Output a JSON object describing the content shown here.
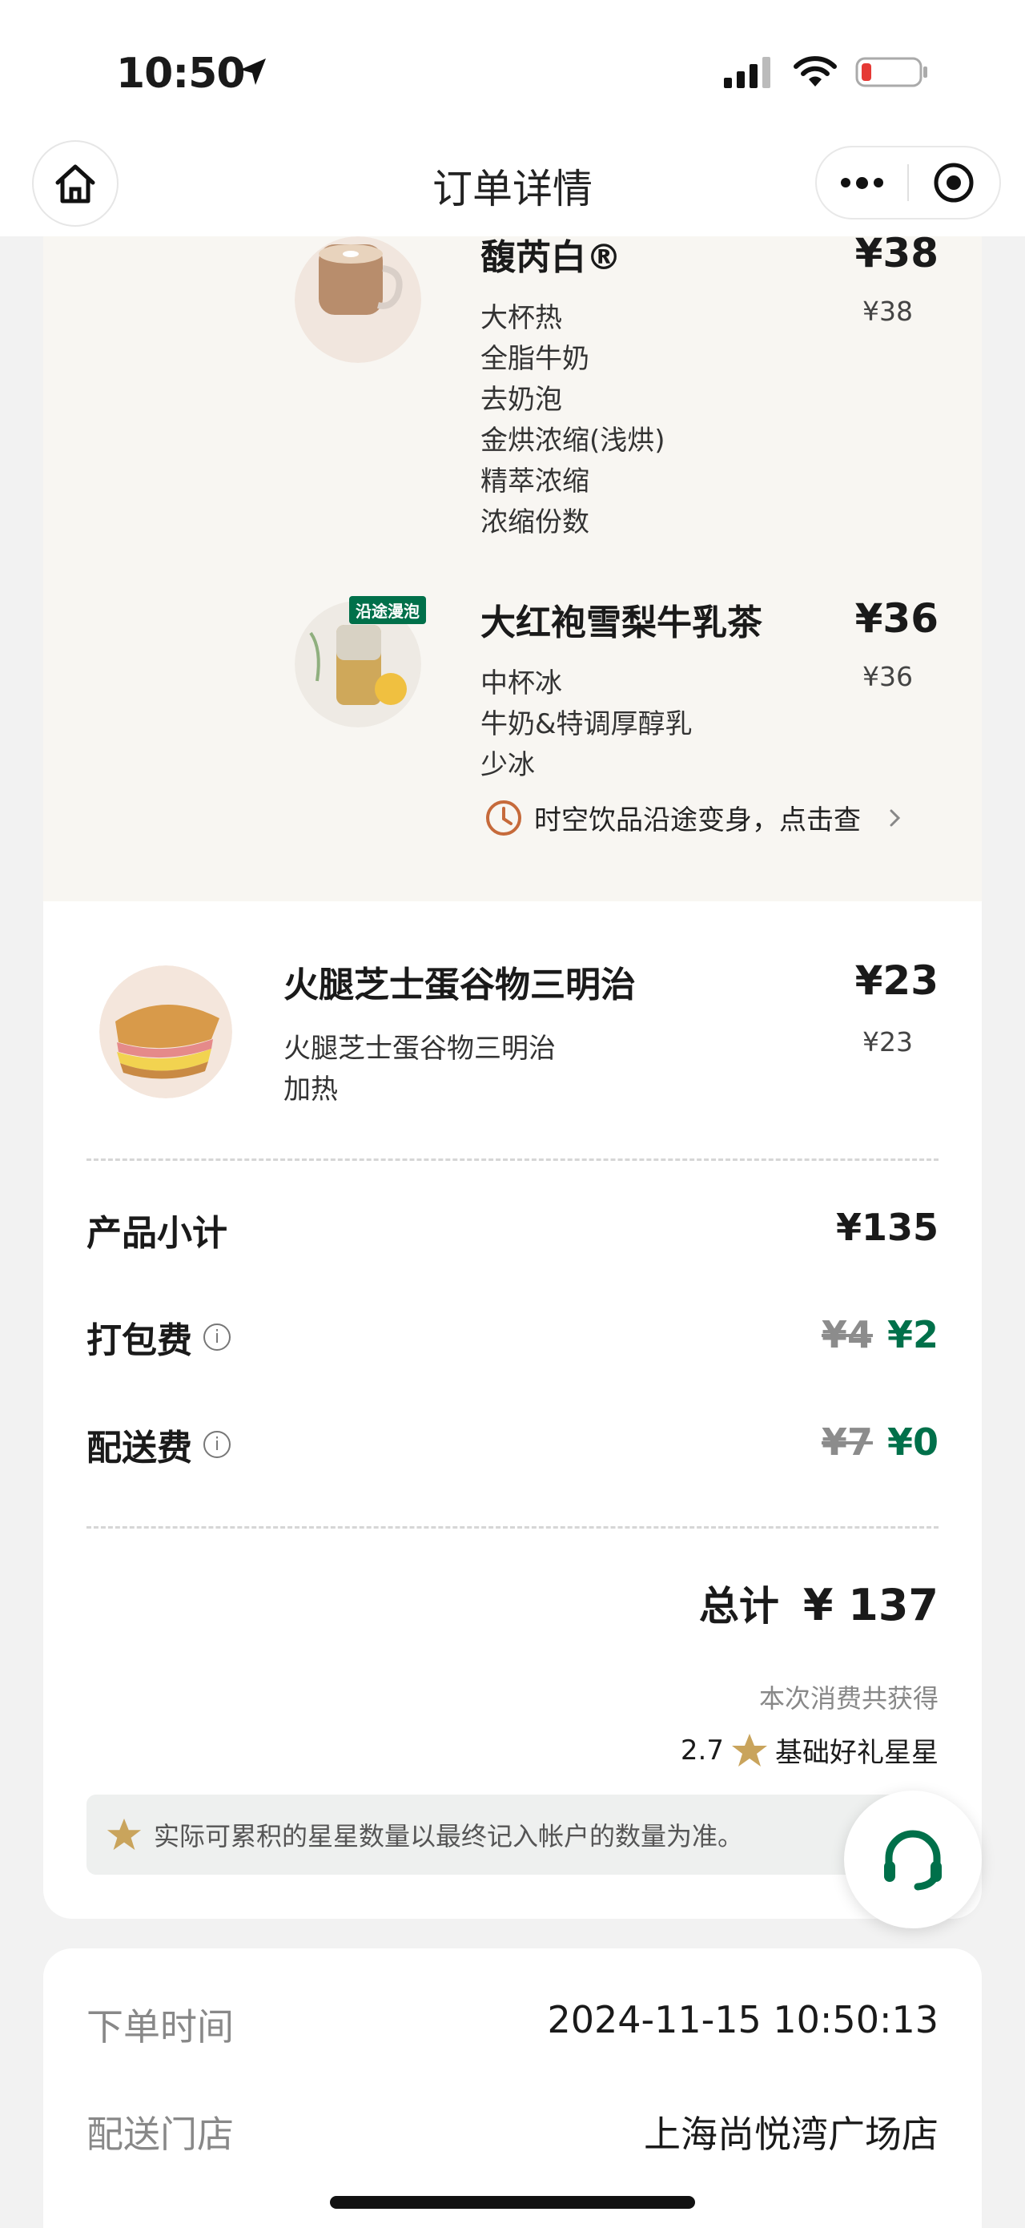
{
  "status_bar": {
    "time": "10:50"
  },
  "nav": {
    "title": "订单详情"
  },
  "drinks": [
    {
      "name": "馥芮白®",
      "price": "¥38",
      "unit_price": "¥38",
      "options": [
        "大杯热",
        "全脂牛奶",
        "去奶泡",
        "金烘浓缩(浅烘)",
        "精萃浓缩",
        "浓缩份数"
      ]
    },
    {
      "name": "大红袍雪梨牛乳茶",
      "price": "¥36",
      "unit_price": "¥36",
      "tag": "沿途漫泡",
      "options": [
        "中杯冰",
        "牛奶&特调厚醇乳",
        "少冰"
      ],
      "link": "时空饮品沿途变身，点击查"
    }
  ],
  "food": {
    "name": "火腿芝士蛋谷物三明治",
    "price": "¥23",
    "unit_price": "¥23",
    "options": [
      "火腿芝士蛋谷物三明治",
      "加热"
    ]
  },
  "summary": {
    "subtotal_label": "产品小计",
    "subtotal_value": "¥135",
    "packing_label": "打包费",
    "packing_original": "¥4",
    "packing_value": "¥2",
    "delivery_label": "配送费",
    "delivery_original": "¥7",
    "delivery_value": "¥0",
    "total_label": "总计",
    "total_value": "¥ 137",
    "earn_note": "本次消费共获得",
    "stars_count": "2.7",
    "stars_label": "基础好礼星星",
    "notice": "实际可累积的星星数量以最终记入帐户的数量为准。"
  },
  "order_info": {
    "time_label": "下单时间",
    "time_value": "2024-11-15 10:50:13",
    "store_label": "配送门店",
    "store_value": "上海尚悦湾广场店"
  },
  "colors": {
    "brand_green": "#00704a",
    "star_gold": "#c9a45c"
  }
}
